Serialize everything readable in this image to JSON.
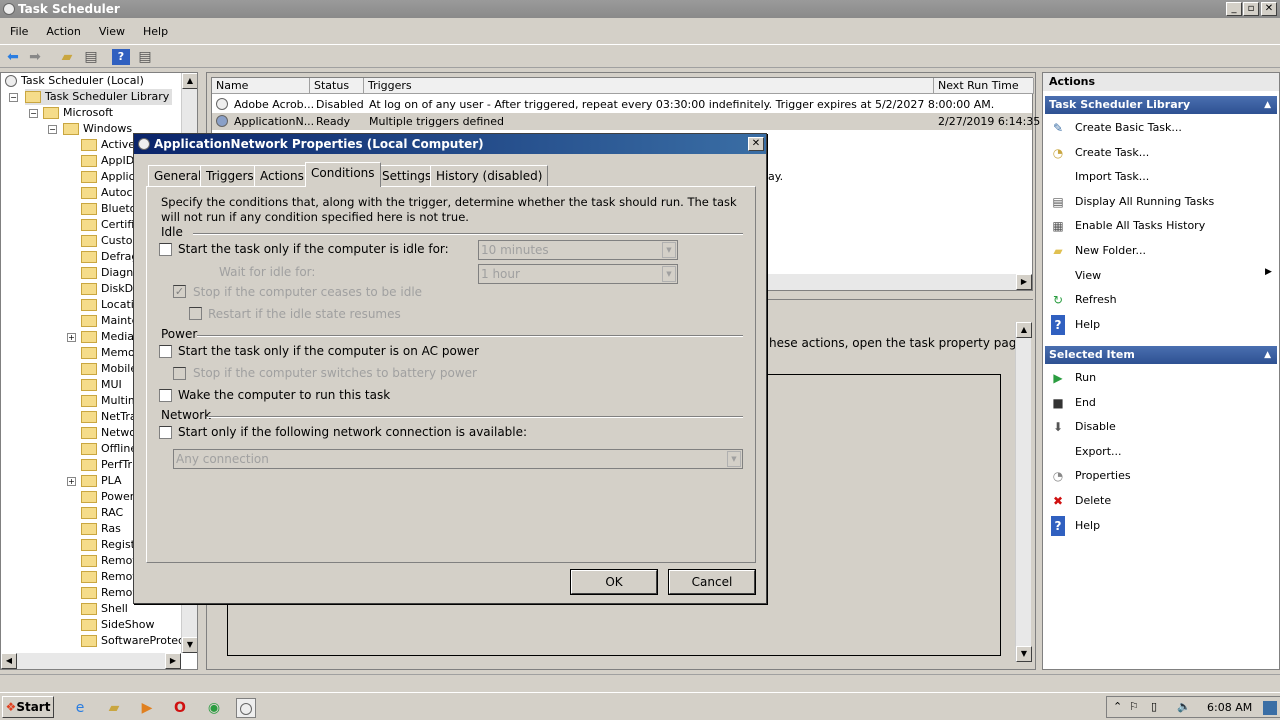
{
  "window": {
    "title": "Task Scheduler"
  },
  "menu": [
    "File",
    "Action",
    "View",
    "Help"
  ],
  "tree": {
    "root": "Task Scheduler (Local)",
    "library": "Task Scheduler Library",
    "microsoft": "Microsoft",
    "windows": "Windows",
    "folders": [
      "Active",
      "AppID",
      "Applica",
      "Autoch",
      "Blueto",
      "Certifi",
      "Custor",
      "Defrag",
      "Diagnc",
      "DiskDia",
      "Locatic",
      "Mainte",
      "Media",
      "Memor",
      "Mobile",
      "MUI",
      "Multim",
      "NetTra",
      "Netwo",
      "Offline",
      "PerfTr",
      "PLA",
      "Power",
      "RAC",
      "Ras",
      "Regist",
      "Remot",
      "Remot",
      "Remov",
      "Shell",
      "SideShow",
      "SoftwareProtecti"
    ],
    "expandable": [
      "Media",
      "PLA"
    ]
  },
  "tasks": {
    "columns": [
      "Name",
      "Status",
      "Triggers",
      "Next Run Time"
    ],
    "rows": [
      {
        "name": "Adobe Acrob...",
        "status": "Disabled",
        "triggers": "At log on of any user - After triggered, repeat every 03:30:00 indefinitely. Trigger expires at 5/2/2027 8:00:00 AM.",
        "next": ""
      },
      {
        "name": "ApplicationN...",
        "status": "Ready",
        "triggers": "Multiple triggers defined",
        "next": "2/27/2019 6:14:35"
      }
    ]
  },
  "center": {
    "fragment1": "ay.",
    "fragment2": "hese actions, open the task property pages"
  },
  "actions": {
    "title": "Actions",
    "section1": "Task Scheduler Library",
    "items1": [
      {
        "label": "Create Basic Task...",
        "icon": "wizard-icon"
      },
      {
        "label": "Create Task...",
        "icon": "task-icon"
      },
      {
        "label": "Import Task...",
        "icon": ""
      },
      {
        "label": "Display All Running Tasks",
        "icon": "list-icon"
      },
      {
        "label": "Enable All Tasks History",
        "icon": "history-icon"
      },
      {
        "label": "New Folder...",
        "icon": "folder-icon"
      },
      {
        "label": "View",
        "icon": ""
      },
      {
        "label": "Refresh",
        "icon": "refresh-icon"
      },
      {
        "label": "Help",
        "icon": "help-icon"
      }
    ],
    "section2": "Selected Item",
    "items2": [
      {
        "label": "Run",
        "icon": "run-icon"
      },
      {
        "label": "End",
        "icon": "stop-icon"
      },
      {
        "label": "Disable",
        "icon": "disable-icon"
      },
      {
        "label": "Export...",
        "icon": ""
      },
      {
        "label": "Properties",
        "icon": "properties-icon"
      },
      {
        "label": "Delete",
        "icon": "delete-icon"
      },
      {
        "label": "Help",
        "icon": "help-icon"
      }
    ]
  },
  "dialog": {
    "title": "ApplicationNetwork Properties (Local Computer)",
    "tabs": [
      "General",
      "Triggers",
      "Actions",
      "Conditions",
      "Settings",
      "History (disabled)"
    ],
    "selected_tab": "Conditions",
    "intro": "Specify the conditions that, along with the trigger, determine whether the task should run.  The task will not run  if any condition specified here is not true.",
    "idle_group": "Idle",
    "idle_start": "Start the task only if the computer is idle for:",
    "idle_for_value": "10 minutes",
    "wait_label": "Wait for idle for:",
    "wait_value": "1 hour",
    "stop_idle": "Stop if the computer ceases to be idle",
    "restart_idle": "Restart if the idle state resumes",
    "power_group": "Power",
    "ac_power": "Start the task only if the computer is on AC power",
    "battery": "Stop if the computer switches to battery power",
    "wake": "Wake the computer to run this task",
    "network_group": "Network",
    "network_start": "Start only if the following network connection is available:",
    "network_value": "Any connection",
    "ok": "OK",
    "cancel": "Cancel",
    "checked": {
      "idle_start": false,
      "stop_idle": true,
      "restart_idle": false,
      "ac_power": false,
      "battery": false,
      "wake": false,
      "network_start": false
    }
  },
  "taskbar": {
    "start": "Start",
    "clock": "6:08 AM"
  },
  "colors": {
    "section_header": "#2e5192",
    "dialog_title": "#0a246a",
    "face": "#d4d0c8"
  }
}
